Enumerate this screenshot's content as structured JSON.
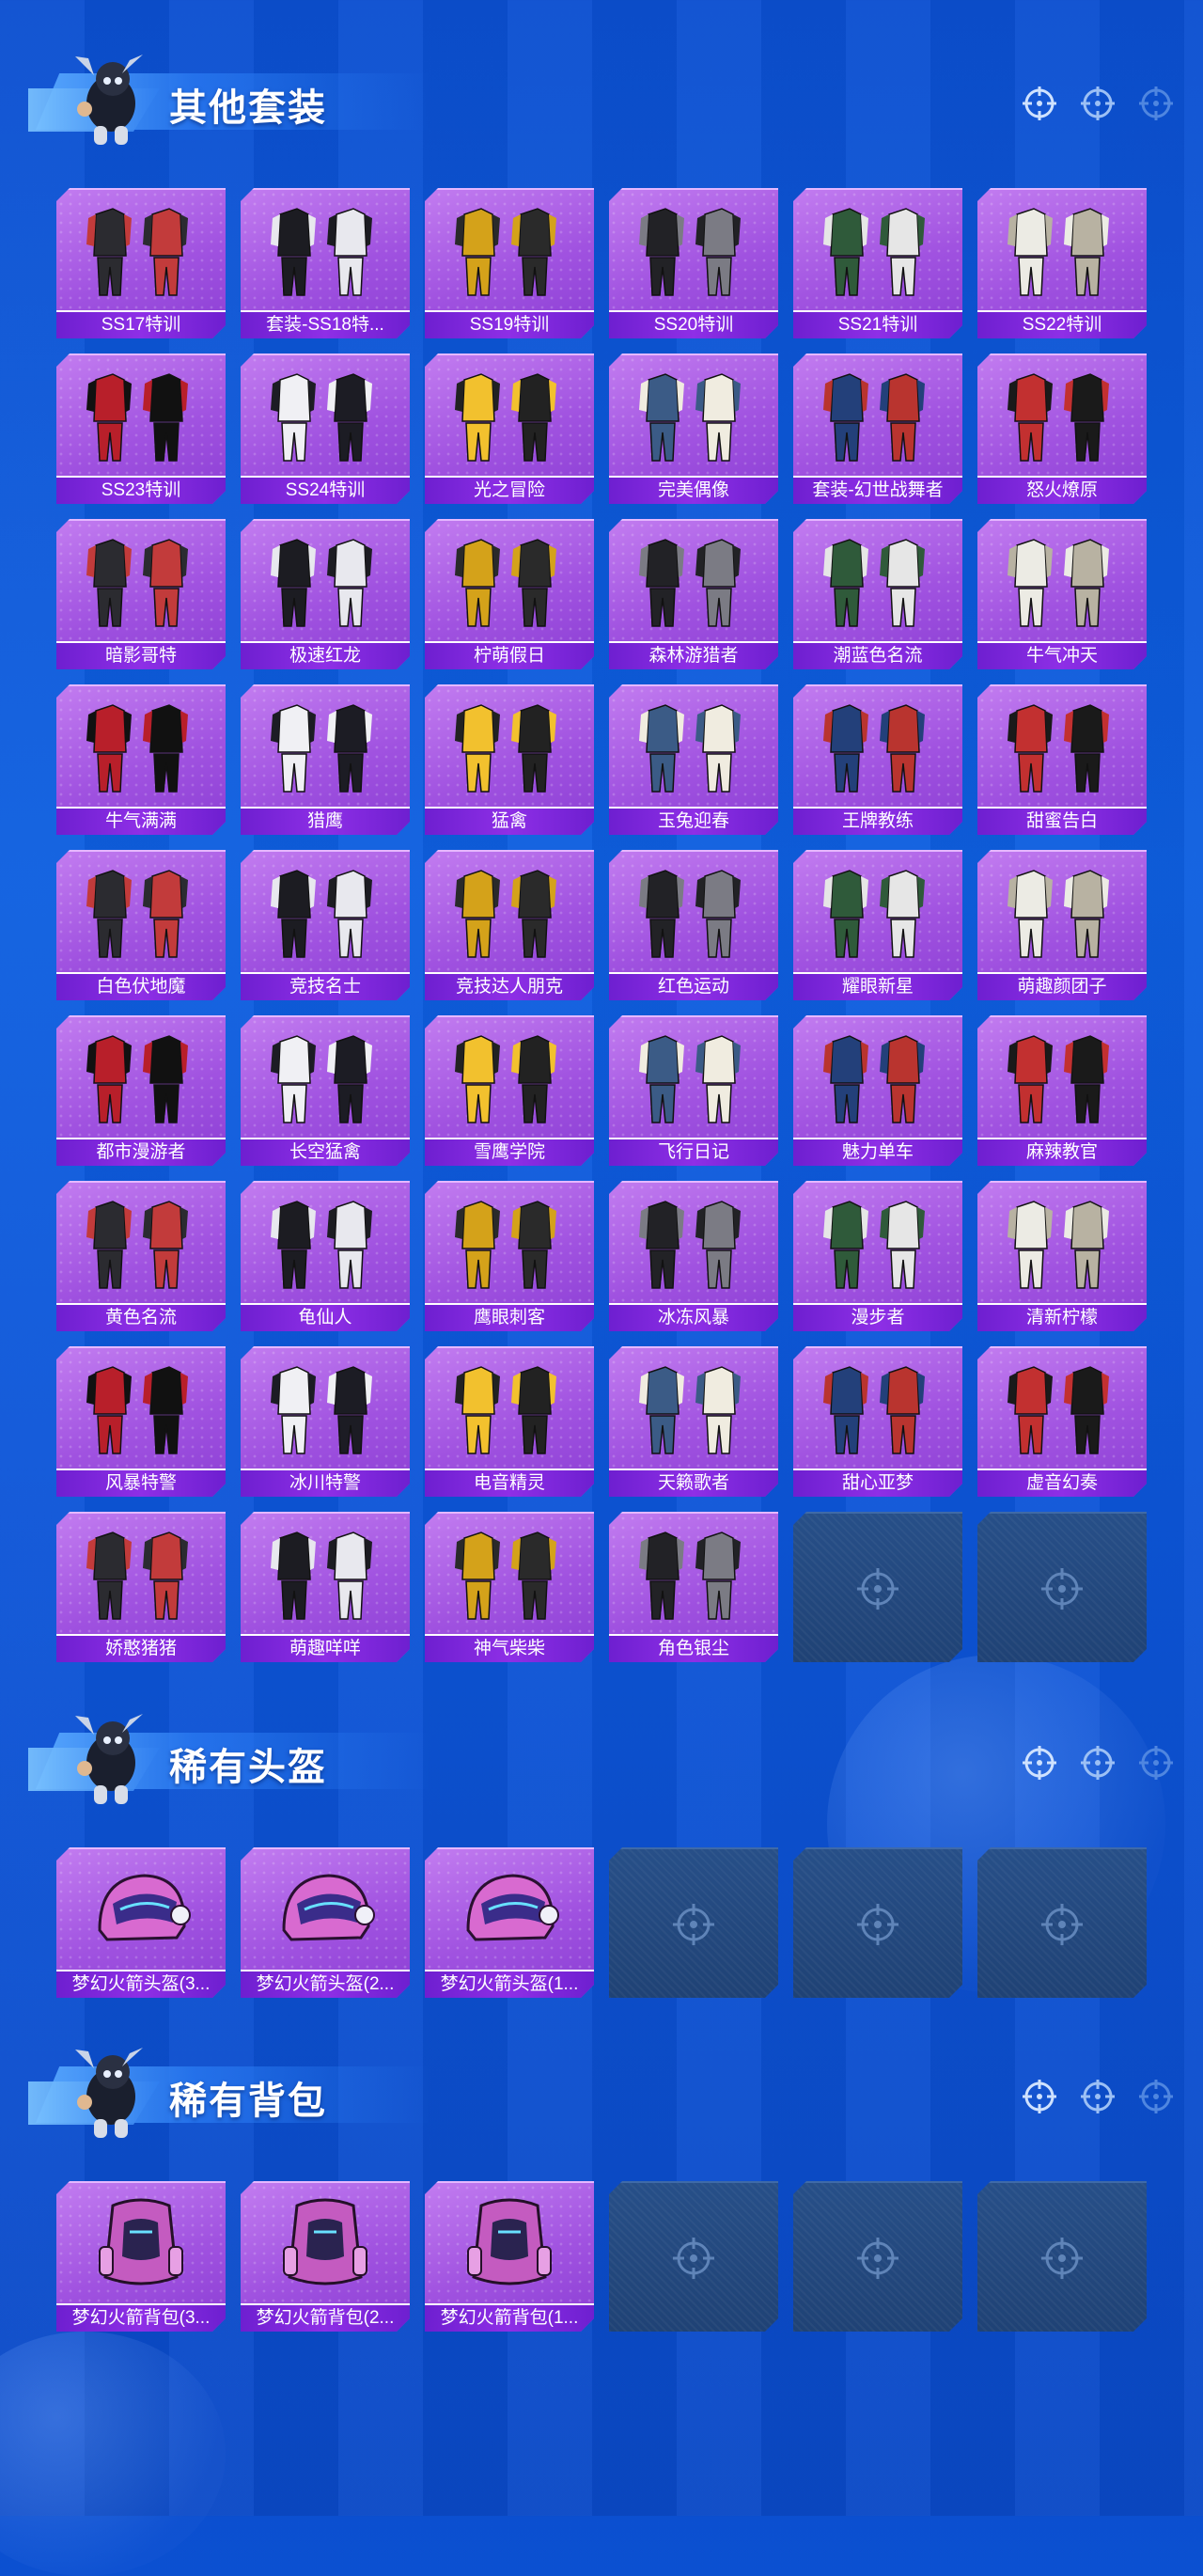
{
  "colors": {
    "background": "#0e5fe0",
    "card": "#a052e0",
    "card_label": "#7a27da",
    "empty_slot": "#234a80"
  },
  "sections": [
    {
      "title": "其他套装",
      "items": [
        "SS17特训",
        "套装-SS18特...",
        "SS19特训",
        "SS20特训",
        "SS21特训",
        "SS22特训",
        "SS23特训",
        "SS24特训",
        "光之冒险",
        "完美偶像",
        "套装-幻世战舞者",
        "怒火燎原",
        "暗影哥特",
        "极速红龙",
        "柠萌假日",
        "森林游猎者",
        "潮蓝色名流",
        "牛气冲天",
        "牛气满满",
        "猎鹰",
        "猛禽",
        "玉兔迎春",
        "王牌教练",
        "甜蜜告白",
        "白色伏地魔",
        "竞技名士",
        "竞技达人朋克",
        "红色运动",
        "耀眼新星",
        "萌趣颜团子",
        "都市漫游者",
        "长空猛禽",
        "雪鹰学院",
        "飞行日记",
        "魅力单车",
        "麻辣教官",
        "黄色名流",
        "龟仙人",
        "鹰眼刺客",
        "冰冻风暴",
        "漫步者",
        "清新柠檬",
        "风暴特警",
        "冰川特警",
        "电音精灵",
        "天籁歌者",
        "甜心亚梦",
        "虚音幻奏",
        "娇憨猪猪",
        "萌趣咩咩",
        "神气柴柴",
        "角色银尘"
      ],
      "empty_slots": 2
    },
    {
      "title": "稀有头盔",
      "items": [
        "梦幻火箭头盔(3...",
        "梦幻火箭头盔(2...",
        "梦幻火箭头盔(1..."
      ],
      "empty_slots": 3
    },
    {
      "title": "稀有背包",
      "items": [
        "梦幻火箭背包(3...",
        "梦幻火箭背包(2...",
        "梦幻火箭背包(1..."
      ],
      "empty_slots": 3
    }
  ]
}
